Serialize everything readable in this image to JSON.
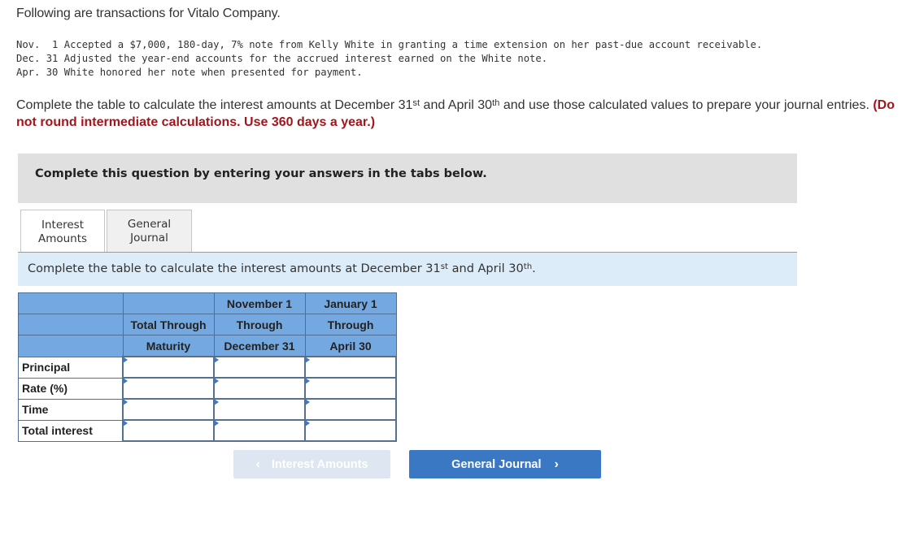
{
  "intro": "Following are transactions for Vitalo Company.",
  "transactions": [
    {
      "month": "Nov.",
      "day": " 1",
      "text": "Accepted a $7,000, 180-day, 7% note from Kelly White in granting a time extension on her past-due account receivable."
    },
    {
      "month": "Dec.",
      "day": "31",
      "text": "Adjusted the year-end accounts for the accrued interest earned on the White note."
    },
    {
      "month": "Apr.",
      "day": "30",
      "text": "White honored her note when presented for payment."
    }
  ],
  "instructions": {
    "part1": "Complete the table to calculate the interest amounts at December 31",
    "sup1": "st",
    "part2": " and April 30",
    "sup2": "th",
    "part3": " and use those calculated values to prepare your journal entries. ",
    "emphasis": "(Do not round intermediate calculations. Use 360 days a year.)"
  },
  "question_box": "Complete this question by entering your answers in the tabs below.",
  "tabs": [
    {
      "line1": "Interest",
      "line2": "Amounts",
      "active": true
    },
    {
      "line1": "General",
      "line2": "Journal",
      "active": false
    }
  ],
  "tab_instruction": {
    "part1": "Complete the table to calculate the interest amounts at December 31",
    "sup1": "st",
    "part2": " and April 30",
    "sup2": "th",
    "part3": "."
  },
  "table": {
    "header_rows": [
      [
        "",
        "",
        "November 1",
        "January 1"
      ],
      [
        "",
        "Total Through",
        "Through",
        "Through"
      ],
      [
        "",
        "Maturity",
        "December 31",
        "April 30"
      ]
    ],
    "rows": [
      {
        "label": "Principal",
        "values": [
          "",
          "",
          ""
        ]
      },
      {
        "label": "Rate (%)",
        "values": [
          "",
          "",
          ""
        ]
      },
      {
        "label": "Time",
        "values": [
          "",
          "",
          ""
        ]
      },
      {
        "label": "Total interest",
        "values": [
          "",
          "",
          ""
        ]
      }
    ]
  },
  "nav": {
    "prev_label": "Interest Amounts",
    "prev_icon": "chevron-left-icon",
    "next_label": "General Journal",
    "next_icon": "chevron-right-icon"
  },
  "colors": {
    "accent_blue": "#3b78c3",
    "header_blue": "#74a8e0",
    "emphasis_red": "#a3151c",
    "panel_blue": "#dcecf8"
  }
}
